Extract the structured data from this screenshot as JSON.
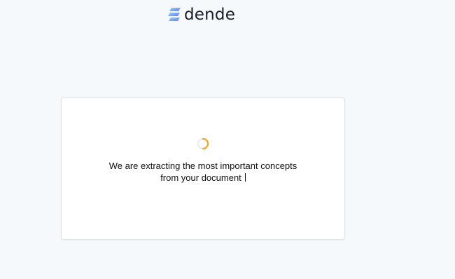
{
  "brand": {
    "name": "dende",
    "logo_icon": "stacked-layers-logo-icon"
  },
  "status": {
    "spinner_icon": "loading-spinner-icon",
    "message_line1": "We are extracting the most important concepts",
    "message_line2": "from your document"
  },
  "colors": {
    "background": "#f6f9fb",
    "card": "#ffffff",
    "spinner_accent": "#f2a51a",
    "logo_top": "#7db3f0",
    "logo_bottom": "#7a6ff0"
  }
}
